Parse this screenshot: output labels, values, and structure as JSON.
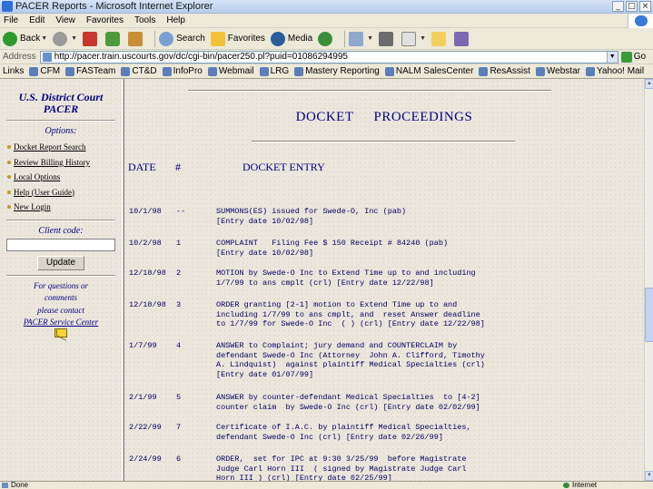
{
  "window": {
    "title": "PACER Reports - Microsoft Internet Explorer",
    "buttons": [
      "_",
      "□",
      "×"
    ]
  },
  "menu": [
    "File",
    "Edit",
    "View",
    "Favorites",
    "Tools",
    "Help"
  ],
  "toolbar": {
    "back": "Back",
    "search": "Search",
    "favorites": "Favorites",
    "media": "Media"
  },
  "address": {
    "label": "Address",
    "url": "http://pacer.train.uscourts.gov/dc/cgi-bin/pacer250.pl?puid=01086294995",
    "go": "Go"
  },
  "links": {
    "label": "Links",
    "items": [
      "CFM",
      "FASTeam",
      "CT&D",
      "InfoPro",
      "Webmail",
      "LRG",
      "Mastery Reporting",
      "NALM SalesCenter",
      "ResAssist",
      "Webstar",
      "Yahoo! Mail"
    ]
  },
  "sidebar": {
    "court_line1": "U.S. District Court",
    "court_line2": "PACER",
    "options_heading": "Options:",
    "links": [
      "Docket Report Search",
      "Review Billing History",
      "Local Options",
      "Help  (User Guide)",
      "New Login"
    ],
    "client_code_label": "Client code:",
    "client_code_value": "",
    "update_button": "Update",
    "help_line1": "For questions or",
    "help_line2": "comments",
    "help_line3": "please contact",
    "service_center": "PACER Service Center"
  },
  "docket": {
    "title": "DOCKET    PROCEEDINGS",
    "col_date": "DATE",
    "col_num": "#",
    "col_entry": "DOCKET    ENTRY",
    "entries": [
      {
        "date": "10/1/98",
        "num": "--",
        "text": "SUMMONS(ES) issued for Swede-O, Inc (pab)\n[Entry date 10/02/98]"
      },
      {
        "date": "10/2/98",
        "num": "1",
        "text": "COMPLAINT   Filing Fee $ 150 Receipt # 84240 (pab)\n[Entry date 10/02/98]"
      },
      {
        "date": "12/18/98",
        "num": "2",
        "text": "MOTION by Swede-O Inc to Extend Time up to and including\n1/7/99 to ans cmplt (crl) [Entry date 12/22/98]"
      },
      {
        "date": "12/18/98",
        "num": "3",
        "text": "ORDER granting [2-1] motion to Extend Time up to and\nincluding 1/7/99 to ans cmplt, and  reset Answer deadline\nto 1/7/99 for Swede-O Inc  ( ) (crl) [Entry date 12/22/98]"
      },
      {
        "date": "1/7/99",
        "num": "4",
        "text": "ANSWER to Complaint; jury demand and COUNTERCLAIM by\ndefendant Swede-O Inc (Attorney  John A. Clifford, Timothy\nA. Lindquist)  against plaintiff Medical Specialties (crl)\n[Entry date 01/07/99]"
      },
      {
        "date": "2/1/99",
        "num": "5",
        "text": "ANSWER by counter-defendant Medical Specialties  to [4-2]\ncounter claim  by Swede-O Inc (crl) [Entry date 02/02/99]"
      },
      {
        "date": "2/22/99",
        "num": "7",
        "text": "Certificate of I.A.C. by plaintiff Medical Specialties,\ndefendant Swede-O Inc (crl) [Entry date 02/26/99]"
      },
      {
        "date": "2/24/99",
        "num": "6",
        "text": "ORDER,  set for IPC at 9:30 3/25/99  before Magistrate\nJudge Carl Horn III  ( signed by Magistrate Judge Carl\nHorn III ) (crl) [Entry date 02/25/99]"
      }
    ]
  },
  "status": {
    "left": "Done",
    "zone": "Internet"
  }
}
